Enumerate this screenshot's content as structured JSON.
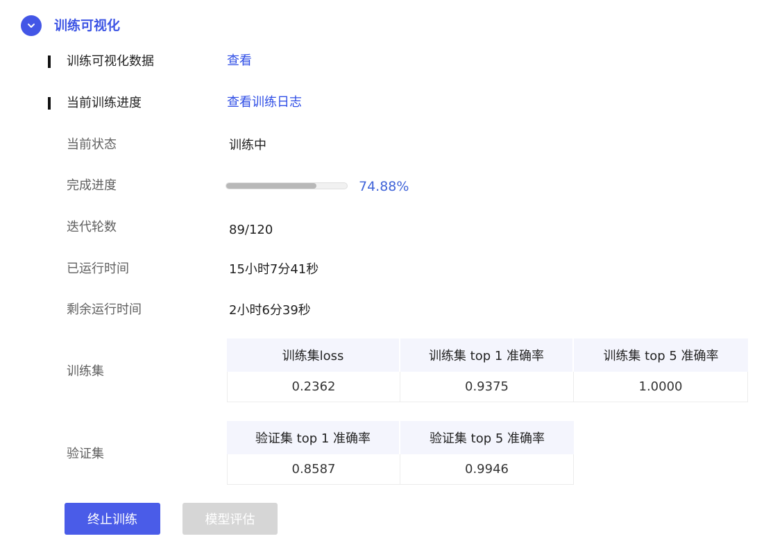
{
  "section": {
    "title": "训练可视化",
    "icon": "chevron-down-icon",
    "accent_color": "#4356e6"
  },
  "visualization": {
    "label": "训练可视化数据",
    "link": "查看"
  },
  "progress_section": {
    "label": "当前训练进度",
    "link": "查看训练日志"
  },
  "status": {
    "label": "当前状态",
    "value": "训练中"
  },
  "completion": {
    "label": "完成进度",
    "percent_text": "74.88%",
    "percent": 74.88
  },
  "epochs": {
    "label": "迭代轮数",
    "value": "89/120"
  },
  "elapsed": {
    "label": "已运行时间",
    "value": "15小时7分41秒"
  },
  "remaining": {
    "label": "剩余运行时间",
    "value": "2小时6分39秒"
  },
  "train_set": {
    "label": "训练集",
    "headers": [
      "训练集loss",
      "训练集 top 1 准确率",
      "训练集 top 5 准确率"
    ],
    "values": [
      "0.2362",
      "0.9375",
      "1.0000"
    ]
  },
  "val_set": {
    "label": "验证集",
    "headers": [
      "验证集 top 1 准确率",
      "验证集 top 5 准确率"
    ],
    "values": [
      "0.8587",
      "0.9946"
    ]
  },
  "buttons": {
    "stop": "终止训练",
    "evaluate": "模型评估"
  }
}
